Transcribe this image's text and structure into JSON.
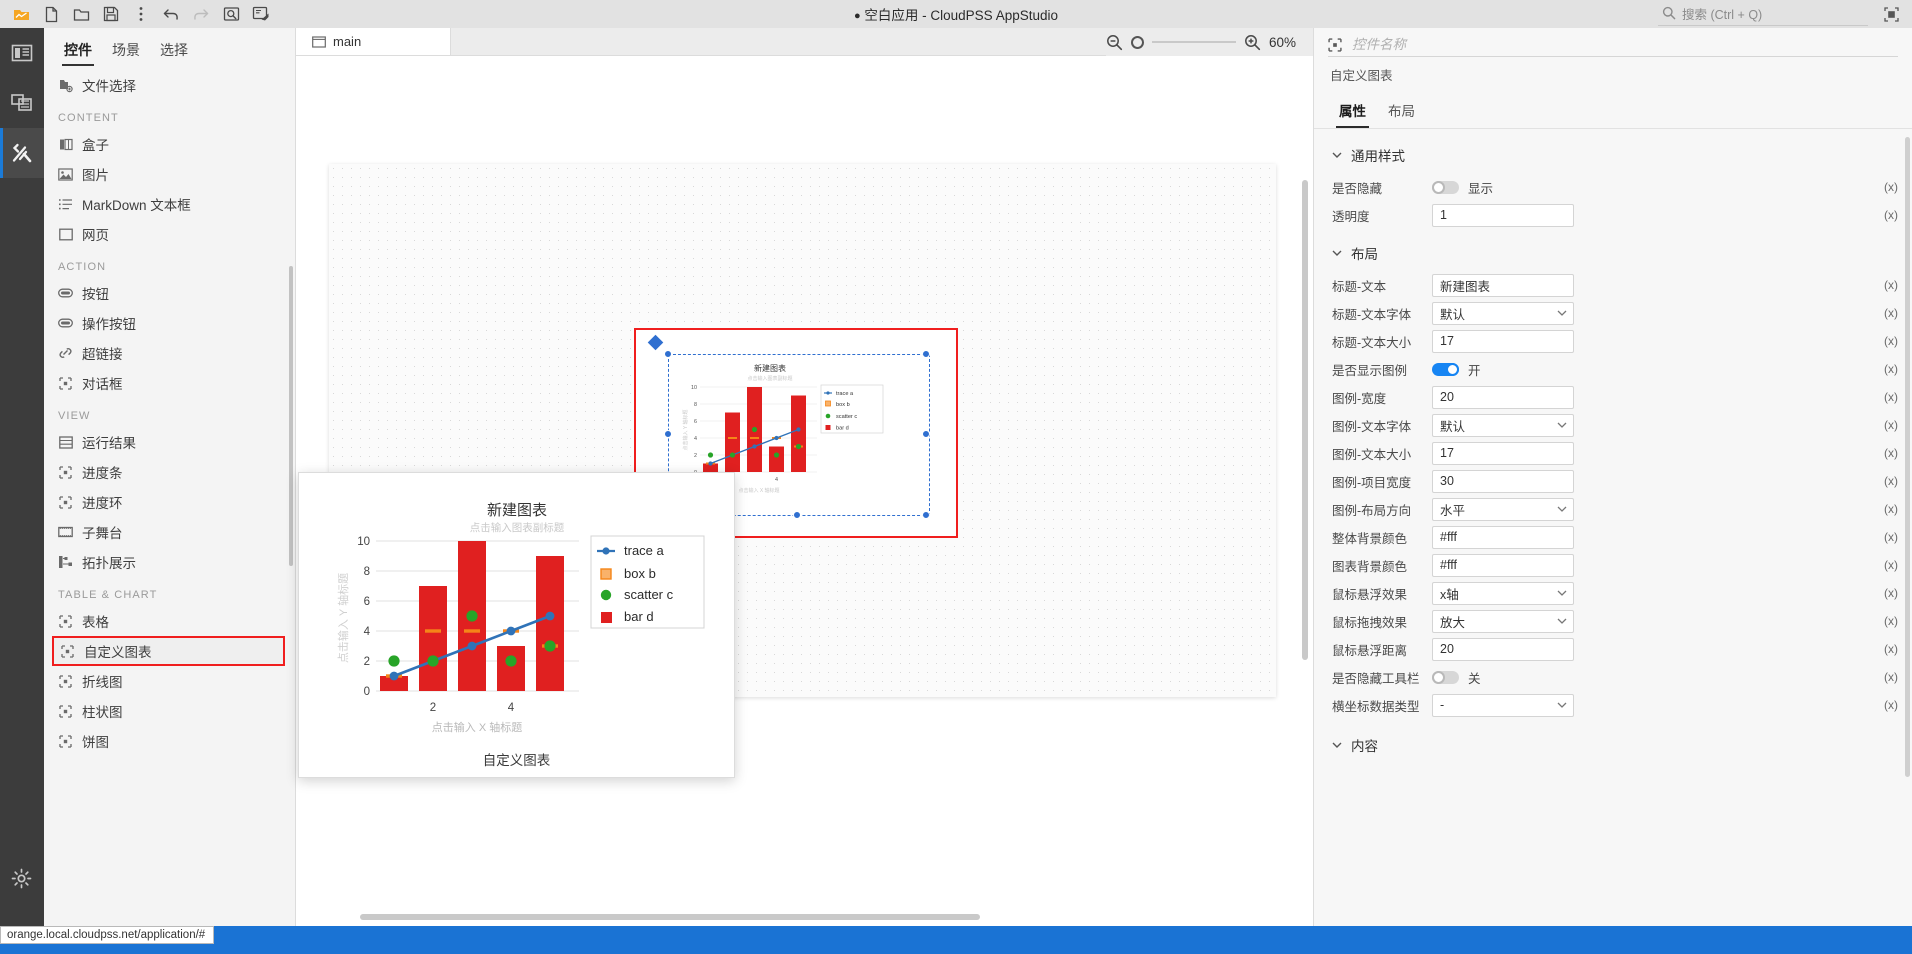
{
  "titlebar": {
    "title": "空白应用 - CloudPSS AppStudio",
    "modified_dot": "●",
    "buttons": [
      {
        "name": "app-logo-icon",
        "label": "CloudPSS"
      },
      {
        "name": "new-file-icon",
        "label": "新建"
      },
      {
        "name": "open-folder-icon",
        "label": "打开"
      },
      {
        "name": "save-icon",
        "label": "保存"
      },
      {
        "name": "more-vertical-icon",
        "label": "更多"
      },
      {
        "name": "undo-icon",
        "label": "撤销"
      },
      {
        "name": "redo-icon",
        "label": "重做"
      },
      {
        "name": "preview-icon",
        "label": "预览"
      },
      {
        "name": "publish-icon",
        "label": "发布"
      }
    ],
    "search_placeholder": "搜索 (Ctrl + Q)",
    "maximize_label": "最大化"
  },
  "rail": {
    "items": [
      {
        "name": "layout-icon",
        "label": "布局"
      },
      {
        "name": "resources-icon",
        "label": "资源"
      },
      {
        "name": "tools-icon",
        "label": "工具",
        "active": true
      }
    ],
    "settings_label": "设置"
  },
  "component_panel": {
    "tabs": [
      {
        "label": "控件",
        "active": true
      },
      {
        "label": "场景",
        "active": false
      },
      {
        "label": "选择",
        "active": false
      }
    ],
    "items": [
      {
        "type": "item",
        "label": "文件选择",
        "icon": "file-select-icon"
      },
      {
        "type": "group",
        "label": "CONTENT"
      },
      {
        "type": "item",
        "label": "盒子",
        "icon": "box-icon"
      },
      {
        "type": "item",
        "label": "图片",
        "icon": "image-icon"
      },
      {
        "type": "item",
        "label": "MarkDown 文本框",
        "icon": "markdown-icon"
      },
      {
        "type": "item",
        "label": "网页",
        "icon": "webpage-icon"
      },
      {
        "type": "group",
        "label": "ACTION"
      },
      {
        "type": "item",
        "label": "按钮",
        "icon": "button-icon"
      },
      {
        "type": "item",
        "label": "操作按钮",
        "icon": "action-button-icon"
      },
      {
        "type": "item",
        "label": "超链接",
        "icon": "link-icon"
      },
      {
        "type": "item",
        "label": "对话框",
        "icon": "dialog-icon"
      },
      {
        "type": "group",
        "label": "VIEW"
      },
      {
        "type": "item",
        "label": "运行结果",
        "icon": "result-icon"
      },
      {
        "type": "item",
        "label": "进度条",
        "icon": "progress-bar-icon"
      },
      {
        "type": "item",
        "label": "进度环",
        "icon": "progress-ring-icon"
      },
      {
        "type": "item",
        "label": "子舞台",
        "icon": "substage-icon"
      },
      {
        "type": "item",
        "label": "拓扑展示",
        "icon": "topology-icon"
      },
      {
        "type": "group",
        "label": "TABLE & CHART"
      },
      {
        "type": "item",
        "label": "表格",
        "icon": "table-icon"
      },
      {
        "type": "item",
        "label": "自定义图表",
        "icon": "custom-chart-icon",
        "selected": true
      },
      {
        "type": "item",
        "label": "折线图",
        "icon": "line-chart-icon"
      },
      {
        "type": "item",
        "label": "柱状图",
        "icon": "bar-chart-icon"
      },
      {
        "type": "item",
        "label": "饼图",
        "icon": "pie-chart-icon"
      }
    ]
  },
  "canvas": {
    "tab_label": "main",
    "tab_icon": "stage-icon",
    "zoom_out_label": "缩小",
    "zoom_in_label": "放大",
    "zoom_value": "60%"
  },
  "preview": {
    "caption": "自定义图表"
  },
  "properties": {
    "name_placeholder": "控件名称",
    "name_value": "",
    "component_type": "自定义图表",
    "tabs": [
      {
        "label": "属性",
        "active": true
      },
      {
        "label": "布局",
        "active": false
      }
    ],
    "sections": [
      {
        "title": "通用样式",
        "rows": [
          {
            "label": "是否隐藏",
            "kind": "switch",
            "on": false,
            "value": "显示",
            "expr": "(x)"
          },
          {
            "label": "透明度",
            "kind": "input",
            "value": "1",
            "expr": "(x)"
          }
        ]
      },
      {
        "title": "布局",
        "rows": [
          {
            "label": "标题-文本",
            "kind": "input",
            "value": "新建图表",
            "expr": "(x)"
          },
          {
            "label": "标题-文本字体",
            "kind": "select",
            "value": "默认",
            "expr": "(x)"
          },
          {
            "label": "标题-文本大小",
            "kind": "input",
            "value": "17",
            "expr": "(x)"
          },
          {
            "label": "是否显示图例",
            "kind": "switch",
            "on": true,
            "value": "开",
            "expr": "(x)"
          },
          {
            "label": "图例-宽度",
            "kind": "input",
            "value": "20",
            "expr": "(x)"
          },
          {
            "label": "图例-文本字体",
            "kind": "select",
            "value": "默认",
            "expr": "(x)"
          },
          {
            "label": "图例-文本大小",
            "kind": "input",
            "value": "17",
            "expr": "(x)"
          },
          {
            "label": "图例-项目宽度",
            "kind": "input",
            "value": "30",
            "expr": "(x)"
          },
          {
            "label": "图例-布局方向",
            "kind": "select",
            "value": "水平",
            "expr": "(x)"
          },
          {
            "label": "整体背景颜色",
            "kind": "input",
            "value": "#fff",
            "expr": "(x)"
          },
          {
            "label": "图表背景颜色",
            "kind": "input",
            "value": "#fff",
            "expr": "(x)"
          },
          {
            "label": "鼠标悬浮效果",
            "kind": "select",
            "value": "x轴",
            "expr": "(x)"
          },
          {
            "label": "鼠标拖拽效果",
            "kind": "select",
            "value": "放大",
            "expr": "(x)"
          },
          {
            "label": "鼠标悬浮距离",
            "kind": "input",
            "value": "20",
            "expr": "(x)"
          },
          {
            "label": "是否隐藏工具栏",
            "kind": "switch",
            "on": false,
            "value": "关",
            "expr": "(x)"
          },
          {
            "label": "横坐标数据类型",
            "kind": "select",
            "value": "-",
            "expr": "(x)"
          }
        ]
      },
      {
        "title": "内容",
        "rows": []
      }
    ]
  },
  "statusbar": {
    "url": "orange.local.cloudpss.net/application/#"
  },
  "colors": {
    "accent_blue": "#1785f3",
    "selection_red": "#f01e1e",
    "bar_red": "#e02020",
    "trace_blue": "#3073b8",
    "box_orange": "#f58518",
    "scatter_green": "#28a428",
    "status_blue": "#1a73d4"
  },
  "chart_data": {
    "type": "bar",
    "title": "新建图表",
    "subtitle": "点击输入图表副标题",
    "xlabel": "点击输入 X 轴标题",
    "ylabel": "点击输入 Y 轴标题",
    "x": [
      1,
      2,
      3,
      4,
      5
    ],
    "xticks": [
      "2",
      "4"
    ],
    "xtick_values": [
      2,
      4
    ],
    "yticks": [
      "0",
      "2",
      "4",
      "6",
      "8",
      "10"
    ],
    "ylim": [
      0,
      10.6
    ],
    "xlim": [
      0.4,
      5.6
    ],
    "grid": true,
    "legend_position": "right",
    "series": [
      {
        "name": "trace a",
        "type": "line",
        "color": "#3073b8",
        "marker": "circle",
        "x": [
          1,
          2,
          3,
          4,
          5
        ],
        "values": [
          1,
          2,
          3,
          4,
          5
        ]
      },
      {
        "name": "box b",
        "type": "box",
        "color": "#f58518",
        "x": [
          1,
          2,
          3,
          4,
          5
        ],
        "medians": [
          1,
          4,
          4,
          4,
          3
        ]
      },
      {
        "name": "scatter c",
        "type": "scatter",
        "color": "#28a428",
        "marker": "circle",
        "x": [
          1,
          2,
          3,
          4,
          5
        ],
        "values": [
          2,
          2,
          5,
          2,
          3
        ]
      },
      {
        "name": "bar d",
        "type": "bar",
        "color": "#e02020",
        "x": [
          1,
          2,
          3,
          4,
          5
        ],
        "values": [
          1,
          7,
          10,
          3,
          9
        ]
      }
    ]
  }
}
